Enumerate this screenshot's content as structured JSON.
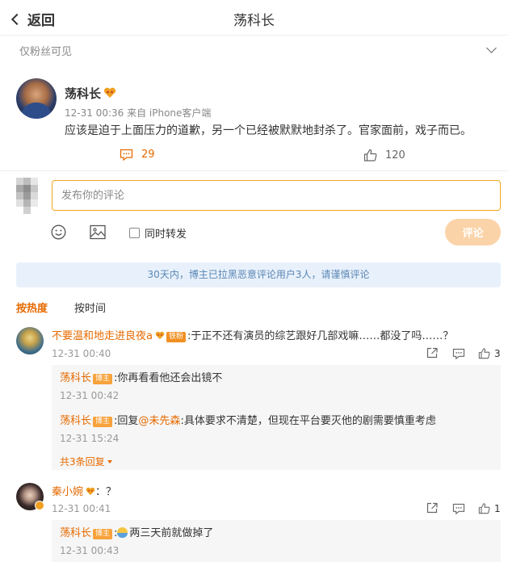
{
  "header": {
    "back_label": "返回",
    "title": "荡科长"
  },
  "visibility": {
    "label": "仅粉丝可见"
  },
  "post": {
    "author": "荡科长",
    "meta": "12-31 00:36  来自 iPhone客户端",
    "text": "应该是迫于上面压力的道歉，另一个已经被默默地封杀了。官家面前，戏子而已。",
    "comments_count": "29",
    "likes_count": "120"
  },
  "composer": {
    "placeholder": "发布你的评论",
    "repost_label": "同时转发",
    "submit_label": "评论"
  },
  "notice": {
    "text": "30天内，博主已拉黑恶意评论用户3人，请谨慎评论"
  },
  "sort": {
    "hot": "按热度",
    "time": "按时间"
  },
  "comments": [
    {
      "name": "不要温和地走进良夜a",
      "badge": "铁粉",
      "text": ":于正不还有演员的综艺跟好几部戏嘛……都没了吗……？",
      "time": "12-31 00:40",
      "likes": "3",
      "replies": [
        {
          "name": "荡科长",
          "badge": "博主",
          "text": ":你再看看他还会出镜不",
          "time": "12-31 00:42"
        },
        {
          "name": "荡科长",
          "badge": "博主",
          "text_prefix": ":回复",
          "mention": "@未先森",
          "text": ":具体要求不清楚，但现在平台要灭他的剧需要慎重考虑",
          "time": "12-31 15:24"
        }
      ],
      "more_replies": "共3条回复"
    },
    {
      "name": "秦小婉",
      "text": "：？",
      "time": "12-31 00:41",
      "likes": "1",
      "replies": [
        {
          "name": "荡科长",
          "badge": "博主",
          "text": "两三天前就做掉了",
          "time": "12-31 00:43"
        }
      ]
    }
  ],
  "colors": {
    "accent": "#e66a00",
    "notice_bg": "#e8f1fb",
    "notice_text": "#5a86b5",
    "submit_bg": "#fbd3a8",
    "input_border": "#f5a623"
  }
}
